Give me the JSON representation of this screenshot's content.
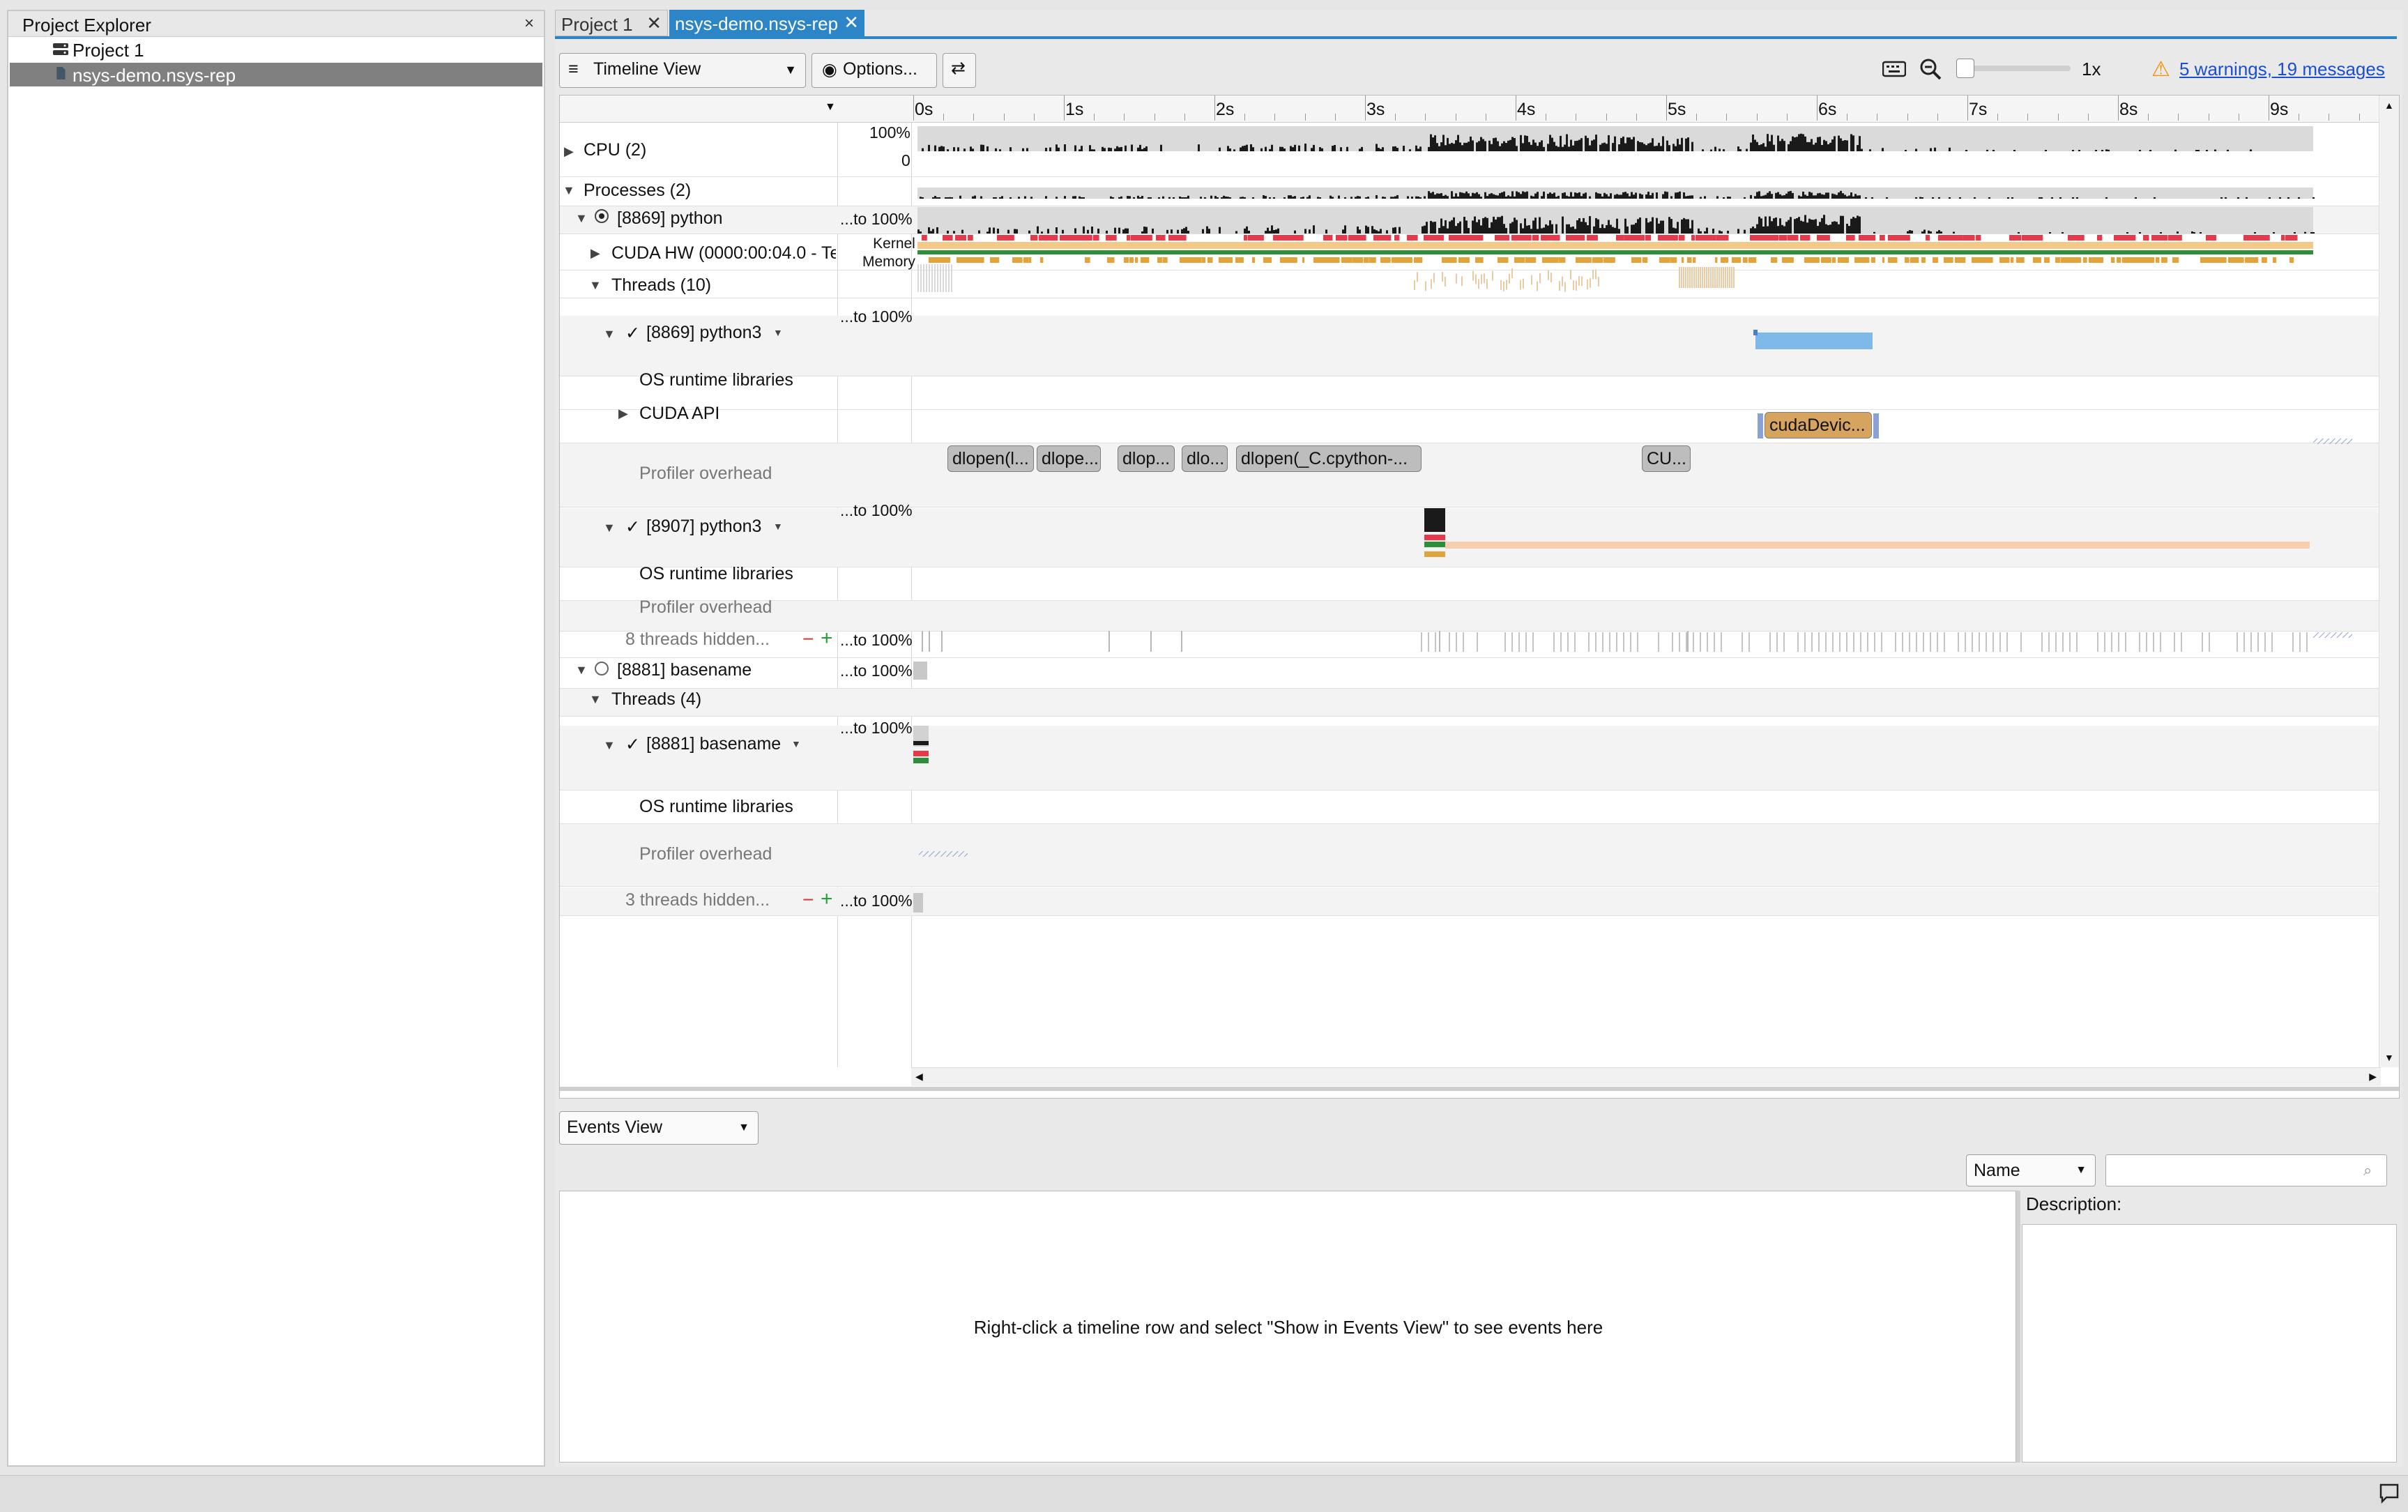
{
  "explorer": {
    "title": "Project Explorer",
    "close": "×",
    "items": [
      {
        "label": "Project 1",
        "icon": "server-icon"
      },
      {
        "label": "nsys-demo.nsys-rep",
        "icon": "file-icon"
      }
    ]
  },
  "tabs": [
    {
      "label": "Project 1",
      "close": "✕"
    },
    {
      "label": "nsys-demo.nsys-rep",
      "close": "✕"
    }
  ],
  "toolbar": {
    "view_select": "Timeline View",
    "options": "Options...",
    "zoom_level": "1x",
    "warnings": "5 warnings, 19 messages"
  },
  "ruler": {
    "ticks": [
      "0s",
      "1s",
      "2s",
      "3s",
      "4s",
      "5s",
      "6s",
      "7s",
      "8s",
      "9s"
    ]
  },
  "rows": {
    "cpu": {
      "label": "CPU (2)",
      "scale_top": "100%",
      "scale_bottom": "0"
    },
    "processes": {
      "label": "Processes (2)"
    },
    "p8869": {
      "label": "[8869] python",
      "scale": "...to 100%"
    },
    "cuda_hw": {
      "label": "CUDA HW (0000:00:04.0 - Te",
      "scale": "Kernel\nMemory"
    },
    "threads10": {
      "label": "Threads (10)"
    },
    "t8869": {
      "label": "[8869] python3",
      "check": "✓",
      "scale": "...to 100%"
    },
    "os_runtime_1": {
      "label": "OS runtime libraries"
    },
    "cuda_api": {
      "label": "CUDA API",
      "event": "cudaDevic..."
    },
    "profiler_overhead_1": {
      "label": "Profiler overhead",
      "events": [
        "dlopen(l...",
        "dlope...",
        "dlop...",
        "dlo...",
        "dlopen(_C.cpython-...",
        "CU..."
      ]
    },
    "t8907": {
      "label": "[8907] python3",
      "check": "✓",
      "scale": "...to 100%"
    },
    "os_runtime_2": {
      "label": "OS runtime libraries"
    },
    "profiler_overhead_2": {
      "label": "Profiler overhead"
    },
    "hidden8": {
      "label": "8 threads hidden...",
      "minus": "−",
      "plus": "+",
      "scale": "...to 100%"
    },
    "p8881": {
      "label": "[8881] basename",
      "scale": "...to 100%"
    },
    "threads4": {
      "label": "Threads (4)"
    },
    "t8881": {
      "label": "[8881] basename",
      "check": "✓",
      "scale": "...to 100%"
    },
    "os_runtime_3": {
      "label": "OS runtime libraries"
    },
    "profiler_overhead_3": {
      "label": "Profiler overhead"
    },
    "hidden3": {
      "label": "3 threads hidden...",
      "minus": "−",
      "plus": "+",
      "scale": "...to 100%"
    }
  },
  "events_view": {
    "select": "Events View",
    "filter_select": "Name",
    "search_placeholder": "",
    "description_label": "Description:",
    "empty_hint": "Right-click a timeline row and select \"Show in Events View\" to see events here"
  },
  "colors": {
    "accent": "#2c85c7",
    "cpu_bar": "#1a1a1a",
    "cuda_kernel": "#7fb9ea",
    "thread_red": "#e8394a",
    "thread_orange": "#f3c98a",
    "thread_green": "#2d8f3a",
    "api_box": "#d7a460",
    "warning": "#f39200",
    "link": "#1a4fd1"
  }
}
